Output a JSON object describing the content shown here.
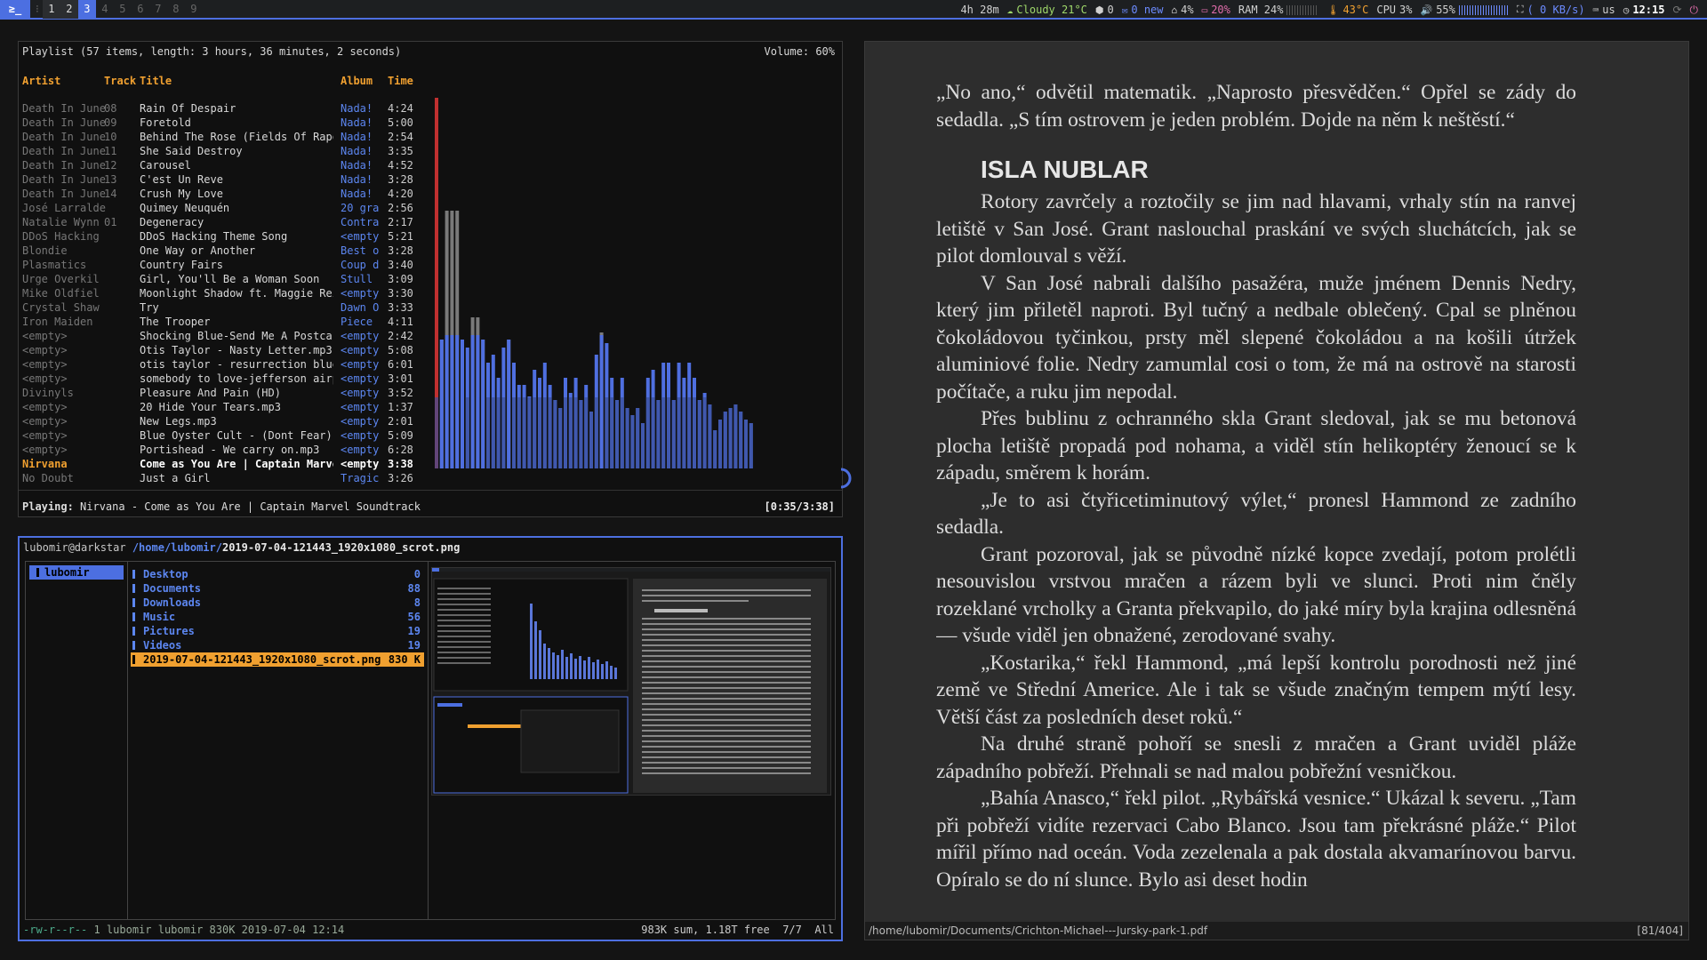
{
  "topbar": {
    "launcher": "≥_",
    "workspaces": [
      {
        "n": "1",
        "state": "occ"
      },
      {
        "n": "2",
        "state": "occ"
      },
      {
        "n": "3",
        "state": "act"
      },
      {
        "n": "4",
        "state": "emp"
      },
      {
        "n": "5",
        "state": "emp"
      },
      {
        "n": "6",
        "state": "emp"
      },
      {
        "n": "7",
        "state": "emp"
      },
      {
        "n": "8",
        "state": "emp"
      },
      {
        "n": "9",
        "state": "emp"
      }
    ],
    "uptime": "4h 28m",
    "weather": "Cloudy 21°C",
    "updates": "0",
    "mail": "0 new",
    "disk": "4%",
    "swap": "20%",
    "ram": "RAM 24%",
    "temp": "43°C",
    "cpu_label": "CPU",
    "cpu": "3%",
    "volume": "55%",
    "net": "( 0 KB/s)",
    "kbd": "us",
    "clock": "12:15",
    "accent": "#4c6fe1"
  },
  "cmus": {
    "playlist_title": "Playlist (57 items, length: 3 hours, 36 minutes, 2 seconds)",
    "volume": "Volume: 60%",
    "columns": {
      "artist": "Artist",
      "track": "Track",
      "title": "Title",
      "album": "Album",
      "time": "Time"
    },
    "rows": [
      {
        "artist": "Death In June",
        "track": "08",
        "title": "Rain Of Despair",
        "album": "Nada!",
        "time": "4:24"
      },
      {
        "artist": "Death In June",
        "track": "09",
        "title": "Foretold",
        "album": "Nada!",
        "time": "5:00"
      },
      {
        "artist": "Death In June",
        "track": "10",
        "title": "Behind The Rose (Fields Of Rape",
        "album": "Nada!",
        "time": "2:54"
      },
      {
        "artist": "Death In June",
        "track": "11",
        "title": "She Said Destroy",
        "album": "Nada!",
        "time": "3:35"
      },
      {
        "artist": "Death In June",
        "track": "12",
        "title": "Carousel",
        "album": "Nada!",
        "time": "4:52"
      },
      {
        "artist": "Death In June",
        "track": "13",
        "title": "C'est Un Reve",
        "album": "Nada!",
        "time": "3:28"
      },
      {
        "artist": "Death In June",
        "track": "14",
        "title": "Crush My Love",
        "album": "Nada!",
        "time": "4:20"
      },
      {
        "artist": "José Larralde",
        "track": "",
        "title": "Quimey Neuquén",
        "album": "20 gra",
        "time": "2:56"
      },
      {
        "artist": "Natalie Wynn",
        "track": "01",
        "title": "Degeneracy",
        "album": "Contra",
        "time": "2:17"
      },
      {
        "artist": "DDoS Hacking",
        "track": "",
        "title": "DDoS Hacking Theme Song",
        "album": "<empty",
        "time": "5:21"
      },
      {
        "artist": "Blondie",
        "track": "",
        "title": "One Way or Another",
        "album": "Best o",
        "time": "3:28"
      },
      {
        "artist": "Plasmatics",
        "track": "",
        "title": "Country Fairs",
        "album": "Coup d",
        "time": "3:40"
      },
      {
        "artist": "Urge Overkil",
        "track": "",
        "title": "Girl, You'll Be a Woman Soon",
        "album": "Stull",
        "time": "3:09"
      },
      {
        "artist": "Mike Oldfiel",
        "track": "",
        "title": "Moonlight Shadow ft. Maggie Rei",
        "album": "<empty",
        "time": "3:30"
      },
      {
        "artist": "Crystal Shaw",
        "track": "",
        "title": "Try",
        "album": "Dawn O",
        "time": "3:33"
      },
      {
        "artist": "Iron Maiden",
        "track": "",
        "title": "The Trooper",
        "album": "Piece",
        "time": "4:11"
      },
      {
        "artist": "<empty>",
        "track": "",
        "title": "Shocking Blue-Send Me A Postcar",
        "album": "<empty",
        "time": "2:42"
      },
      {
        "artist": "<empty>",
        "track": "",
        "title": "Otis Taylor - Nasty Letter.mp3",
        "album": "<empty",
        "time": "5:08"
      },
      {
        "artist": "<empty>",
        "track": "",
        "title": "otis taylor - resurrection blue",
        "album": "<empty",
        "time": "6:01"
      },
      {
        "artist": "<empty>",
        "track": "",
        "title": "somebody to love-jefferson airp",
        "album": "<empty",
        "time": "3:01"
      },
      {
        "artist": "Divinyls",
        "track": "",
        "title": "Pleasure And Pain (HD)",
        "album": "<empty",
        "time": "3:52"
      },
      {
        "artist": "<empty>",
        "track": "",
        "title": "20 Hide Your Tears.mp3",
        "album": "<empty",
        "time": "1:37"
      },
      {
        "artist": "<empty>",
        "track": "",
        "title": "New Legs.mp3",
        "album": "<empty",
        "time": "2:01"
      },
      {
        "artist": "<empty>",
        "track": "",
        "title": "Blue Oyster Cult - (Dont Fear)",
        "album": "<empty",
        "time": "5:09"
      },
      {
        "artist": "<empty>",
        "track": "",
        "title": "Portishead - We carry on.mp3",
        "album": "<empty",
        "time": "6:28"
      },
      {
        "artist": "Nirvana",
        "track": "",
        "title": "Come as You Are | Captain Marve",
        "album": "<empty",
        "time": "3:38",
        "current": true
      },
      {
        "artist": "No Doubt",
        "track": "",
        "title": "Just a Girl",
        "album": "Tragic",
        "time": "3:26"
      }
    ],
    "playing_label": "Playing:",
    "playing": "Nirvana - Come as You Are | Captain Marvel Soundtrack",
    "position": "[0:35/3:38]",
    "visualizer_levels": [
      0.98,
      0.34,
      0.68,
      0.68,
      0.68,
      0.34,
      0.32,
      0.4,
      0.4,
      0.34,
      0.28,
      0.3,
      0.24,
      0.32,
      0.34,
      0.28,
      0.22,
      0.22,
      0.19,
      0.26,
      0.24,
      0.28,
      0.22,
      0.18,
      0.16,
      0.24,
      0.2,
      0.24,
      0.18,
      0.22,
      0.15,
      0.3,
      0.36,
      0.33,
      0.24,
      0.18,
      0.24,
      0.16,
      0.14,
      0.16,
      0.12,
      0.24,
      0.26,
      0.18,
      0.28,
      0.28,
      0.18,
      0.28,
      0.24,
      0.28,
      0.24,
      0.18,
      0.2,
      0.17,
      0.1,
      0.13,
      0.15,
      0.16,
      0.17,
      0.15,
      0.13,
      0.12
    ]
  },
  "ranger": {
    "user_host": "lubomir@darkstar",
    "dir": "/home/lubomir/",
    "file": "2019-07-04-121443_1920x1080_scrot.png",
    "parent_entry": "lubomir",
    "entries": [
      {
        "name": "Desktop",
        "count": "0"
      },
      {
        "name": "Documents",
        "count": "88"
      },
      {
        "name": "Downloads",
        "count": "8"
      },
      {
        "name": "Music",
        "count": "56"
      },
      {
        "name": "Pictures",
        "count": "19"
      },
      {
        "name": "Videos",
        "count": "19"
      },
      {
        "name": "2019-07-04-121443_1920x1080_scrot.png",
        "count": "830 K",
        "selected": true
      }
    ],
    "status_left_perm": "-rw-r--r--",
    "status_left_rest": " 1 lubomir lubomir 830K 2019-07-04 12:14",
    "status_right": "983K sum, 1.18T free  7/7  All"
  },
  "pdf": {
    "paragraphs": [
      {
        "text": "„No ano,“ odvětil matematik. „Naprosto přesvědčen.“ Opřel se zády do sedadla. „S tím ostrovem je jeden problém. Dojde na něm k neštěstí.“",
        "noind": true
      },
      {
        "heading": "ISLA NUBLAR"
      },
      {
        "text": "Rotory zavrčely a roztočily se jim nad hlavami, vrhaly stín na ranvej letiště v San José. Grant naslouchal praskání ve svých sluchátcích, jak se pilot domlouval s věží."
      },
      {
        "text": "V San José nabrali dalšího pasažéra, muže jménem Dennis Nedry, který jim přiletěl naproti. Byl tučný a nedbale oblečený. Cpal se plněnou čokoládovou tyčinkou, prsty měl slepené čokoládou a na košili útržek aluminiové folie. Nedry zamumlal cosi o tom, že má na ostrově na starosti počítače, a ruku jim nepodal."
      },
      {
        "text": "Přes bublinu z ochranného skla Grant sledoval, jak se mu betonová plocha letiště propadá pod nohama, a viděl stín helikoptéry ženoucí se k západu, směrem k horám."
      },
      {
        "text": "„Je to asi čtyřicetiminutový výlet,“ pronesl Hammond ze zadního sedadla."
      },
      {
        "text": "Grant pozoroval, jak se původně nízké kopce zvedají, potom prolétli nesouvislou vrstvou mračen a rázem byli ve slunci. Proti nim čněly rozeklané vrcholky a Granta překvapilo, do jaké míry byla krajina odlesněná — všude viděl jen obnažené, zerodované svahy."
      },
      {
        "text": "„Kostarika,“ řekl Hammond, „má lepší kontrolu porodnosti než jiné země ve Střední Americe. Ale i tak se všude značným tempem mýtí lesy. Větší část za posledních deset roků.“"
      },
      {
        "text": "Na druhé straně pohoří se snesli z mračen a Grant uviděl pláže západního pobřeží. Přehnali se nad malou pobřežní vesničkou."
      },
      {
        "text": "„Bahía Anasco,“ řekl pilot. „Rybářská vesnice.“ Ukázal k severu. „Tam při pobřeží vidíte rezervaci Cabo Blanco. Jsou tam překrásné pláže.“ Pilot mířil přímo nad oceán. Voda zezelenala a pak dostala akvamarínovou barvu. Opíralo se do ní slunce. Bylo asi deset hodin"
      }
    ],
    "path": "/home/lubomir/Documents/Crichton-Michael---Jursky-park-1.pdf",
    "pages": "[81/404]"
  }
}
